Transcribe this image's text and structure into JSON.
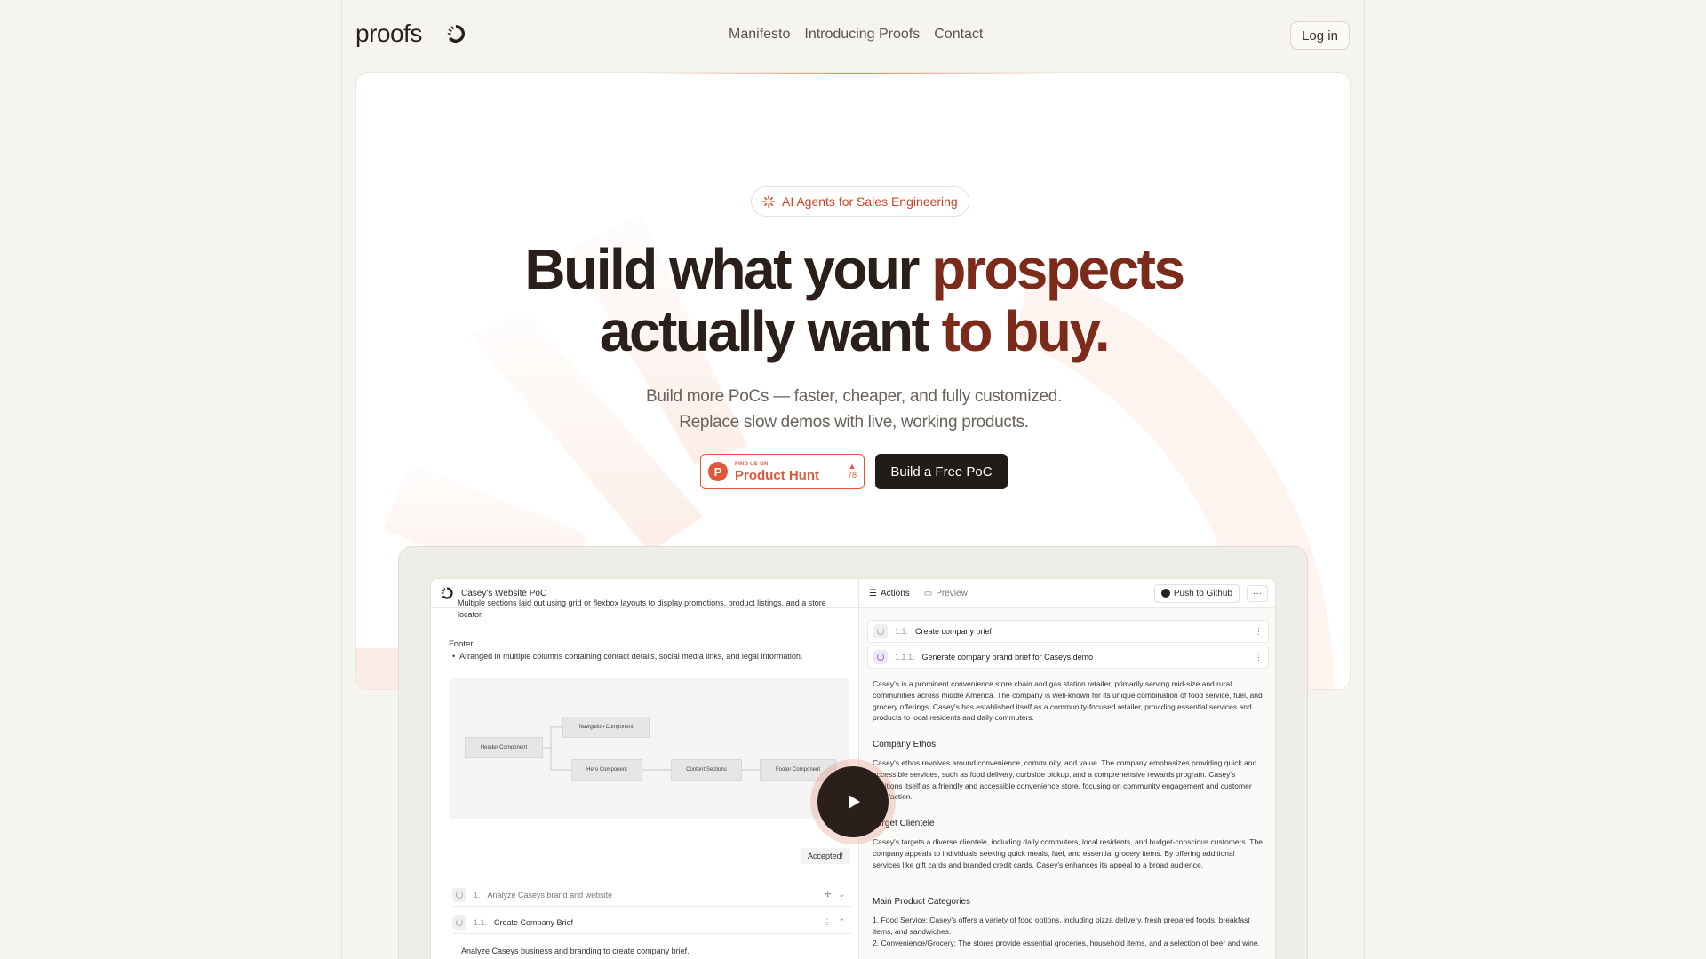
{
  "header": {
    "logo_text": "proofs",
    "nav": [
      "Manifesto",
      "Introducing Proofs",
      "Contact"
    ],
    "login_label": "Log in"
  },
  "hero": {
    "badge": "AI Agents for Sales Engineering",
    "headline_part1": "Build what your",
    "headline_part2": "prospects",
    "headline_line2_dark": "actually want",
    "headline_line2_red": "to buy.",
    "sub_line1": "Build more PoCs — faster, cheaper, and fully customized.",
    "sub_line2": "Replace slow demos with live, working products.",
    "ph_small": "FIND US ON",
    "ph_big": "Product Hunt",
    "ph_votes": "78",
    "cta_label": "Build a Free PoC"
  },
  "demo": {
    "left": {
      "title": "Casey's Website PoC",
      "clipped_text": "Multiple sections laid out using grid or flexbox layouts to display promotions, product listings, and a store locator.",
      "footer_heading": "Footer",
      "footer_bullet": "Arranged in multiple columns containing contact details, social media links, and legal information.",
      "diagram": {
        "header": "Header Component",
        "navigation": "Navigation Component",
        "hero": "Hero Component",
        "content": "Content Sections",
        "footer": "Footer Component"
      },
      "accepted": "Accepted!",
      "task1_num": "1.",
      "task1_label": "Analyze Caseys brand and website",
      "task2_num": "1.1.",
      "task2_label": "Create Company Brief",
      "task2_desc": "Analyze Caseys business and branding to create company brief."
    },
    "right": {
      "actions_label": "Actions",
      "preview_label": "Preview",
      "push_label": "Push to Github",
      "more_label": "···",
      "item1_num": "1.1.",
      "item1_label": "Create company brief",
      "item2_num": "1.1.1.",
      "item2_label": "Generate company brand brief for Caseys demo",
      "intro": "Casey's is a prominent convenience store chain and gas station retailer, primarily serving mid-size and rural communities across middle America. The company is well-known for its unique combination of food service, fuel, and grocery offerings. Casey's has established itself as a community-focused retailer, providing essential services and products to local residents and daily commuters.",
      "ethos_heading": "Company Ethos",
      "ethos_text": "Casey's ethos revolves around convenience, community, and value. The company emphasizes providing quick and accessible services, such as food delivery, curbside pickup, and a comprehensive rewards program. Casey's positions itself as a friendly and accessible convenience store, focusing on community engagement and customer satisfaction.",
      "clientele_heading": "Target Clientele",
      "clientele_text": "Casey's targets a diverse clientele, including daily commuters, local residents, and budget-conscious customers. The company appeals to individuals seeking quick meals, fuel, and essential grocery items. By offering additional services like gift cards and branded credit cards, Casey's enhances its appeal to a broad audience.",
      "categories_heading": "Main Product Categories",
      "cat1": "1. Food Service: Casey's offers a variety of food options, including pizza delivery, fresh prepared foods, breakfast items, and sandwiches.",
      "cat2": "2. Convenience/Grocery: The stores provide essential groceries, household items, and a selection of beer and wine."
    }
  },
  "colors": {
    "accent": "#7c2a1a",
    "brand_orange": "#e0573a",
    "dark": "#221c19"
  }
}
